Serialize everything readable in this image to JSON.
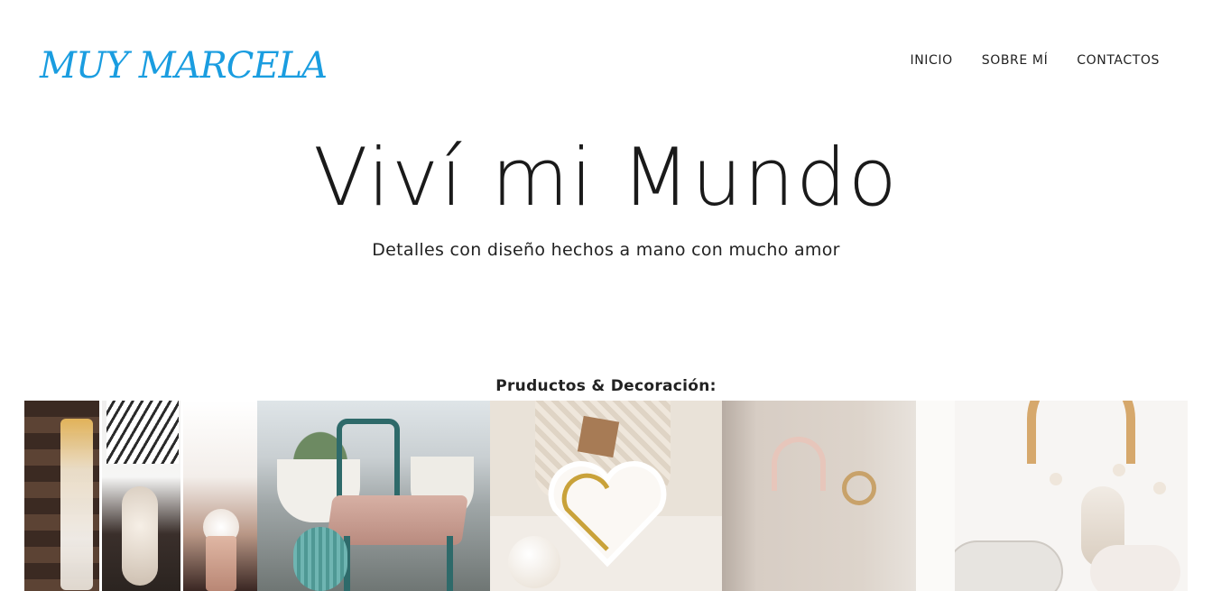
{
  "header": {
    "logo": "MUY MARCELA",
    "nav": [
      "INICIO",
      "SOBRE MÍ",
      "CONTACTOS"
    ]
  },
  "hero": {
    "title": "Viví mi Mundo",
    "subtitle": "Detalles con diseño hechos a mano con mucho amor"
  },
  "gallery": {
    "heading": "Pruductos & Decoración:"
  },
  "colors": {
    "logo": "#1a9de0",
    "text": "#222222",
    "background": "#ffffff"
  }
}
